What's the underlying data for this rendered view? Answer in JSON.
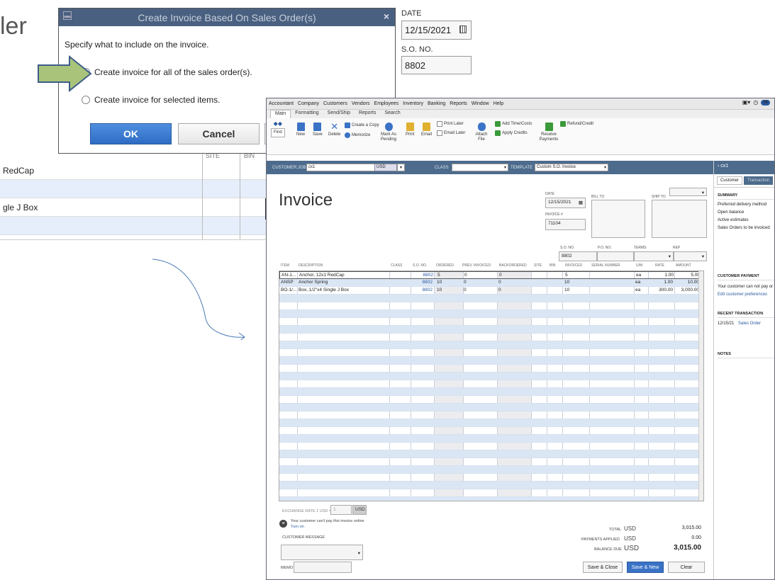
{
  "background": {
    "title_fragment": "ler",
    "date_label": "DATE",
    "date_value": "12/15/2021",
    "so_label": "S.O. NO.",
    "so_value": "8802",
    "table": {
      "headers": [
        "SITE",
        "BIN"
      ],
      "rows": [
        "RedCap",
        "",
        "gle J Box",
        ""
      ]
    }
  },
  "dialog": {
    "title": "Create Invoice Based On Sales Order(s)",
    "close": "×",
    "instruction": "Specify what to include on the invoice.",
    "option_all": "Create invoice for all of the sales order(s).",
    "option_selected": "Create invoice for selected items.",
    "ok": "OK",
    "cancel": "Cancel"
  },
  "qb": {
    "menu": [
      "Accountant",
      "Company",
      "Customers",
      "Vendors",
      "Employees",
      "Inventory",
      "Banking",
      "Reports",
      "Window",
      "Help"
    ],
    "notif_count": "98",
    "tabs": [
      "Main",
      "Formatting",
      "Send/Ship",
      "Reports",
      "Search"
    ],
    "ribbon": {
      "find": "Find",
      "new": "New",
      "save": "Save",
      "delete": "Delete",
      "create_copy": "Create a Copy",
      "memorize": "Memorize",
      "mark_as_pending": "Mark As Pending",
      "print": "Print",
      "email": "Email",
      "print_later": "Print Later",
      "email_later": "Email Later",
      "attach_file": "Attach File",
      "add_time_costs": "Add Time/Costs",
      "apply_credits": "Apply Credits",
      "receive_payments": "Receive Payments",
      "refund_credit": "Refund/Credit"
    },
    "custbar": {
      "customer_job_label": "CUSTOMER:JOB",
      "customer_job_value": "cx1",
      "currency": "USD",
      "class_label": "CLASS",
      "template_label": "TEMPLATE",
      "template_value": "Custom S.O. Invoice"
    },
    "invoice": {
      "title": "Invoice",
      "date_label": "DATE",
      "date_value": "12/15/2021",
      "invoice_no_label": "INVOICE #",
      "invoice_no_value": "71104",
      "bill_to_label": "BILL TO",
      "ship_to_label": "SHIP TO",
      "so_no_label": "S.O. NO.",
      "so_no_value": "8802",
      "po_no_label": "P.O. NO.",
      "terms_label": "TERMS",
      "rep_label": "REP"
    },
    "columns": [
      "ITEM",
      "DESCRIPTION",
      "CLASS",
      "S.O. NO.",
      "ORDERED",
      "PREV. INVOICED",
      "BACKORDERED",
      "SITE",
      "BIN",
      "INVOICED",
      "SERIAL NUMBER",
      "U/M",
      "RATE",
      "AMOUNT"
    ],
    "lines": [
      {
        "item": "AN-1...",
        "description": "Anchor, 12x1 RedCap",
        "so": "8802",
        "ordered": "5",
        "prev": "0",
        "back": "0",
        "invoiced": "5",
        "um": "ea",
        "rate": "1.00",
        "amount": "5.00"
      },
      {
        "item": "ANSP",
        "description": "Anchor Spring",
        "so": "8802",
        "ordered": "10",
        "prev": "0",
        "back": "0",
        "invoiced": "10",
        "um": "ea",
        "rate": "1.00",
        "amount": "10.00"
      },
      {
        "item": "BO-1/...",
        "description": "Box, 1/2\"x4 Single J Box",
        "so": "8802",
        "ordered": "10",
        "prev": "0",
        "back": "0",
        "invoiced": "10",
        "um": "ea",
        "rate": "300.00",
        "amount": "3,000.00"
      }
    ],
    "bottom": {
      "exchange_rate_label": "EXCHANGE RATE 1 USD =",
      "exchange_rate_value": "1",
      "exchange_currency": "USD",
      "online_note": "Your customer can't pay this invoice online",
      "turn_on": "Turn on",
      "customer_message_label": "CUSTOMER MESSAGE",
      "memo_label": "MEMO",
      "total_label": "TOTAL",
      "total_currency": "USD",
      "total_value": "3,015.00",
      "payments_label": "PAYMENTS APPLIED",
      "payments_currency": "USD",
      "payments_value": "0.00",
      "balance_label": "BALANCE DUE",
      "balance_currency": "USD",
      "balance_value": "3,015.00",
      "save_close": "Save & Close",
      "save_new": "Save & New",
      "clear": "Clear"
    },
    "panel": {
      "header": "cx1",
      "tab_customer": "Customer",
      "tab_transaction": "Transaction",
      "summary": "SUMMARY",
      "summary_items": [
        "Preferred delivery method",
        "Open balance",
        "Active estimates",
        "Sales Orders to be invoiced"
      ],
      "customer_payment": "CUSTOMER PAYMENT",
      "payment_note": "Your customer can not pay or",
      "edit_prefs": "Edit customer preferences",
      "recent": "RECENT TRANSACTION",
      "recent_date": "12/15/21",
      "recent_link": "Sales Order",
      "notes": "NOTES"
    }
  }
}
